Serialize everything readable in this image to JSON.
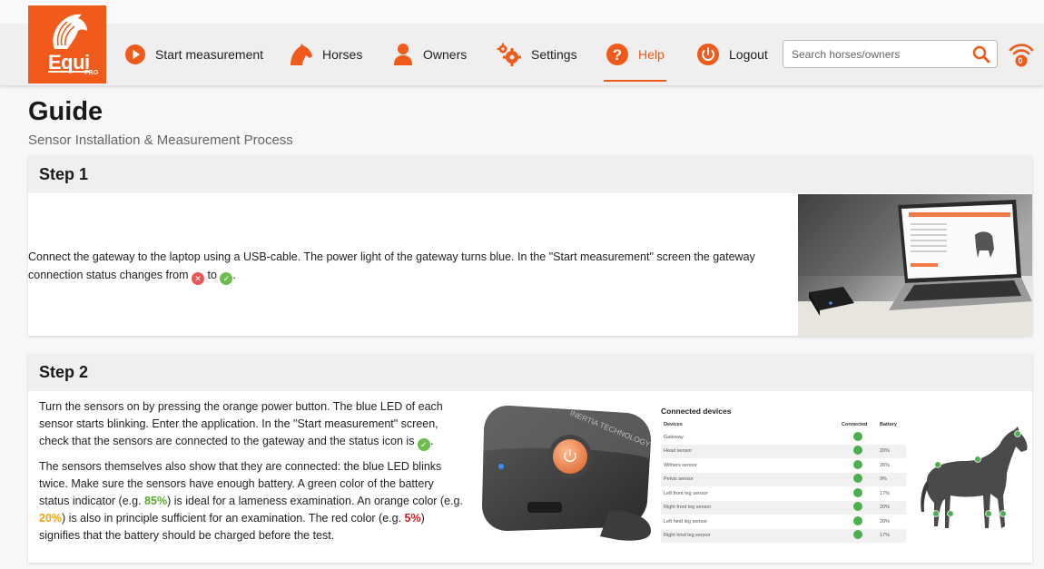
{
  "app": {
    "logo_word": "Equi",
    "logo_sub": "PRO"
  },
  "nav": {
    "items": [
      {
        "label": "Start measurement",
        "icon": "play-circle-icon"
      },
      {
        "label": "Horses",
        "icon": "horse-head-icon"
      },
      {
        "label": "Owners",
        "icon": "person-icon"
      },
      {
        "label": "Settings",
        "icon": "gears-icon"
      },
      {
        "label": "Help",
        "icon": "question-circle-icon",
        "active": true
      },
      {
        "label": "Logout",
        "icon": "power-icon"
      }
    ],
    "search_placeholder": "Search horses/owners",
    "wifi_count": "0"
  },
  "page": {
    "title": "Guide",
    "subtitle": "Sensor Installation & Measurement Process"
  },
  "step1": {
    "heading": "Step 1",
    "text_before": "Connect the gateway to the laptop using a USB-cable. The power light of the gateway turns blue. In the \"Start measurement\" screen the gateway connection status changes from",
    "text_mid": "to",
    "text_end": "."
  },
  "step2": {
    "heading": "Step 2",
    "p1_text": "Turn the sensors on by pressing the orange power button. The blue LED of each sensor starts blinking. Enter the application. In the \"Start measurement\" screen, check that the sensors are connected to the gateway and the status icon is",
    "p1_end": ".",
    "p2_a": "The sensors themselves also show that they are connected: the blue LED blinks twice. Make sure the sensors have enough battery. A green color of the battery status indicator (e.g.",
    "p2_green": "85%",
    "p2_b": ") is ideal for a lameness examination. An orange color (e.g.",
    "p2_orange": "20%",
    "p2_c": ") is also in principle sufficient for an examination. The red color (e.g.",
    "p2_red": "5%",
    "p2_d": ") signifies that the battery should be charged before the test.",
    "sensor_brand": "INERTIA TECHNOLOGY",
    "devices_title": "Connected devices",
    "devices_headers": [
      "Devices",
      "Connected",
      "Battery"
    ],
    "devices_rows": [
      {
        "name": "Gateway",
        "battery": ""
      },
      {
        "name": "Head sensor",
        "battery": "20%"
      },
      {
        "name": "Withers sensor",
        "battery": "26%"
      },
      {
        "name": "Pelvis sensor",
        "battery": "9%"
      },
      {
        "name": "Left front leg sensor",
        "battery": "17%"
      },
      {
        "name": "Right front leg sensor",
        "battery": "20%"
      },
      {
        "name": "Left hind leg sensor",
        "battery": "20%"
      },
      {
        "name": "Right hind leg sensor",
        "battery": "17%"
      }
    ]
  },
  "colors": {
    "brand": "#f05a1a",
    "ok_green": "#6cbc4f",
    "error_red": "#e55555",
    "battery_green": "#5aa832",
    "battery_orange": "#f5a00d",
    "battery_red": "#d01c1c"
  }
}
